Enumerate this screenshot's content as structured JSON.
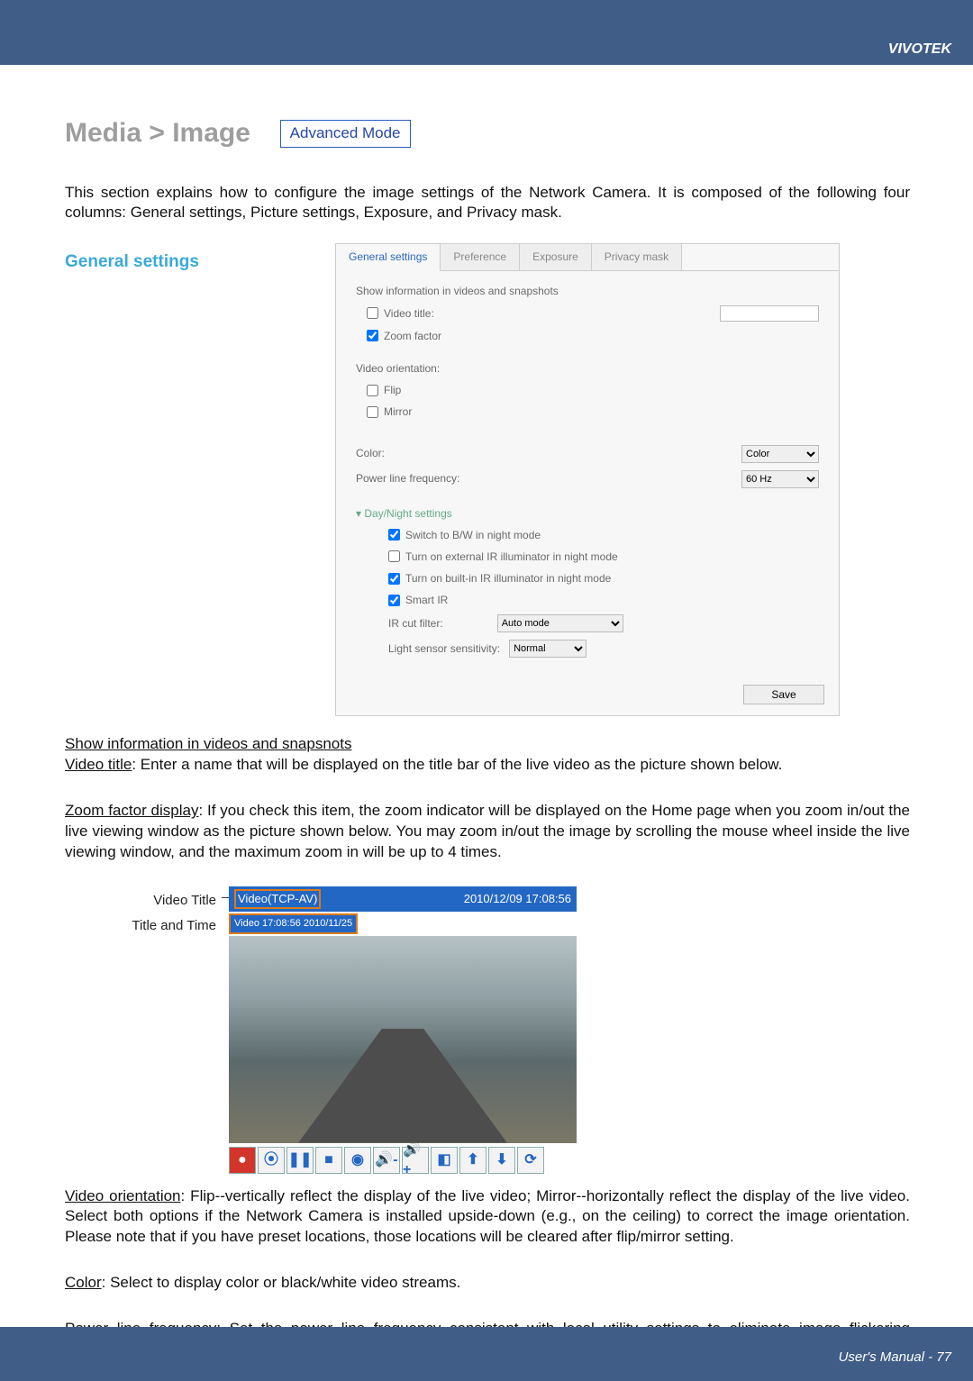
{
  "header": {
    "brand": "VIVOTEK"
  },
  "breadcrumb": {
    "text": "Media > Image"
  },
  "badge": {
    "label": "Advanced Mode"
  },
  "intro": "This section explains how to configure the image settings of the Network Camera. It is composed of the following four columns: General settings, Picture settings, Exposure, and Privacy mask.",
  "section_heading": "General settings",
  "panel": {
    "tabs": [
      "General settings",
      "Preference",
      "Exposure",
      "Privacy mask"
    ],
    "group1_title": "Show information in videos and snapshots",
    "video_title_label": "Video title:",
    "zoom_factor_label": "Zoom factor",
    "orientation_heading": "Video orientation:",
    "flip_label": "Flip",
    "mirror_label": "Mirror",
    "color_label": "Color:",
    "color_value": "Color",
    "freq_label": "Power line frequency:",
    "freq_value": "60 Hz",
    "daynight_heading": "Day/Night settings",
    "dn_opt1": "Switch to B/W in night mode",
    "dn_opt2": "Turn on external IR illuminator in night mode",
    "dn_opt3": "Turn on built-in IR illuminator in night mode",
    "dn_opt4": "Smart IR",
    "ircut_label": "IR cut filter:",
    "ircut_value": "Auto mode",
    "light_sens_label": "Light sensor sensitivity:",
    "light_sens_value": "Normal",
    "save_label": "Save"
  },
  "body": {
    "sub1_title": "Show information in videos and snapsnots",
    "video_title_term": "Video title",
    "video_title_text": ": Enter a name that will be displayed on the title bar of the live video as the picture shown below.",
    "zoom_term": "Zoom factor display",
    "zoom_text": ": If you check this item, the zoom indicator will be displayed on the Home page when you zoom in/out the live viewing window as the picture shown below.  You may zoom in/out the image by scrolling the mouse wheel inside the live viewing window, and the maximum zoom in will be up to 4 times.",
    "label_video_title": "Video Title",
    "label_title_time": "Title and Time",
    "bar1_left": "Video(TCP-AV)",
    "bar1_right": "2010/12/09 17:08:56",
    "bar2_text": "Video 17:08:56 2010/11/25",
    "orient_term": "Video orientation",
    "orient_text": ": Flip--vertically reflect the display of the live video; Mirror--horizontally reflect the display of the live video. Select both options if the Network Camera is installed upside-down (e.g., on the ceiling) to correct the image orientation. Please note that if you have preset locations, those locations will be cleared after flip/mirror setting.",
    "color_term": "Color",
    "color_text": ": Select to display color or black/white video streams.",
    "plf_term": "Power line frequency",
    "plf_text": ": Set the power line frequency consistent with local utility settings to eliminate image flickering associated with fluorescent lights. Note that after the power line frequency is changed, you must disconnect and reconnect the power cord of the Network Camera in order for the new setting to take effect."
  },
  "toolbar_icons": [
    "●",
    "⦿",
    "❚❚",
    "■",
    "◉",
    "🔊-",
    "🔊+",
    "◧",
    "⬆",
    "⬇",
    "⟳"
  ],
  "footer": {
    "text": "User's Manual - 77"
  }
}
